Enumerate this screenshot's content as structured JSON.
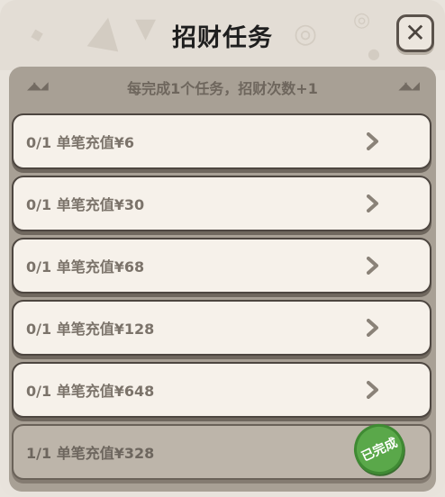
{
  "header": {
    "title": "招财任务",
    "close_icon": "close-icon"
  },
  "banner": {
    "text": "每完成1个任务，招财次数+1"
  },
  "tasks": [
    {
      "progress": "0/1",
      "label": "单笔充值¥6",
      "status": "incomplete"
    },
    {
      "progress": "0/1",
      "label": "单笔充值¥30",
      "status": "incomplete"
    },
    {
      "progress": "0/1",
      "label": "单笔充值¥68",
      "status": "incomplete"
    },
    {
      "progress": "0/1",
      "label": "单笔充值¥128",
      "status": "incomplete"
    },
    {
      "progress": "0/1",
      "label": "单笔充值¥648",
      "status": "incomplete"
    },
    {
      "progress": "1/1",
      "label": "单笔充值¥328",
      "status": "complete",
      "stamp": "已完成"
    }
  ],
  "colors": {
    "panel": "#e8e3dc",
    "row": "#f6f1ea",
    "row_done": "#bdb5aa",
    "stamp": "#5aa84a",
    "text": "#7b736a"
  }
}
